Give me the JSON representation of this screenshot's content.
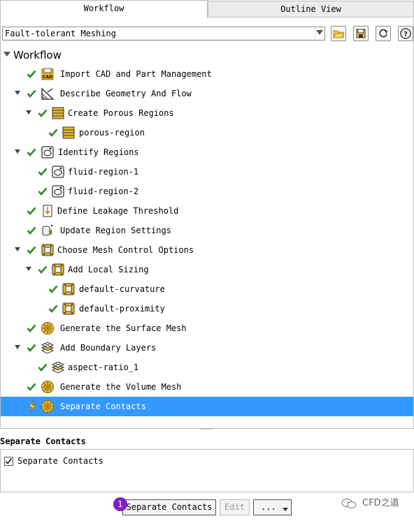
{
  "tabs": [
    {
      "label": "Workflow",
      "active": true
    },
    {
      "label": "Outline View",
      "active": false
    }
  ],
  "toolbar": {
    "workflow_select": "Fault-tolerant Meshing",
    "buttons": [
      "open-folder-icon",
      "save-icon",
      "refresh-icon",
      "help-icon"
    ]
  },
  "tree": {
    "root_label": "Workflow",
    "items": [
      {
        "label": "Import CAD and Part Management",
        "icon": "cad-import-icon",
        "expandable": false,
        "checked": true
      },
      {
        "label": "Describe Geometry And Flow",
        "icon": "geometry-icon",
        "expandable": true,
        "checked": true
      },
      {
        "label": "Create Porous Regions",
        "icon": "table-icon",
        "expandable": true,
        "checked": true
      },
      {
        "label": "porous-region",
        "icon": "table-icon",
        "expandable": false,
        "checked": true
      },
      {
        "label": "Identify Regions",
        "icon": "region-icon",
        "expandable": true,
        "checked": true
      },
      {
        "label": "fluid-region-1",
        "icon": "region-icon",
        "expandable": false,
        "checked": true
      },
      {
        "label": "fluid-region-2",
        "icon": "region-icon",
        "expandable": false,
        "checked": true
      },
      {
        "label": "Define Leakage Threshold",
        "icon": "leakage-icon",
        "expandable": false,
        "checked": true
      },
      {
        "label": "Update Region Settings",
        "icon": "region-settings-icon",
        "expandable": false,
        "checked": true
      },
      {
        "label": "Choose Mesh Control Options",
        "icon": "mesh-control-icon",
        "expandable": true,
        "checked": true
      },
      {
        "label": "Add Local Sizing",
        "icon": "mesh-control-icon",
        "expandable": true,
        "checked": true
      },
      {
        "label": "default-curvature",
        "icon": "mesh-control-icon",
        "expandable": false,
        "checked": true
      },
      {
        "label": "default-proximity",
        "icon": "mesh-control-icon",
        "expandable": false,
        "checked": true
      },
      {
        "label": "Generate the Surface Mesh",
        "icon": "sphere-mesh-icon",
        "expandable": false,
        "checked": true
      },
      {
        "label": "Add Boundary Layers",
        "icon": "boundary-layer-icon",
        "expandable": true,
        "checked": true
      },
      {
        "label": "aspect-ratio_1",
        "icon": "boundary-layer-icon",
        "expandable": false,
        "checked": true
      },
      {
        "label": "Generate the Volume Mesh",
        "icon": "sphere-mesh-icon",
        "expandable": false,
        "checked": true
      },
      {
        "label": "Separate Contacts",
        "icon": "sphere-mesh-icon",
        "expandable": false,
        "checked": false,
        "selected": true,
        "status_icon": "lightning-icon"
      }
    ]
  },
  "task_panel": {
    "title": "Separate Contacts",
    "checkbox_label": "Separate Contacts",
    "checkbox_checked": true
  },
  "actions": {
    "primary_label": "Separate Contacts",
    "edit_label": "Edit",
    "more_label": "...",
    "step_badge": "1"
  },
  "watermark": {
    "text": "CFD之道"
  },
  "colors": {
    "selection": "#3399ff",
    "check": "#2e8b2e",
    "icon_gold": "#e8b833",
    "badge": "#7e1fc6"
  }
}
